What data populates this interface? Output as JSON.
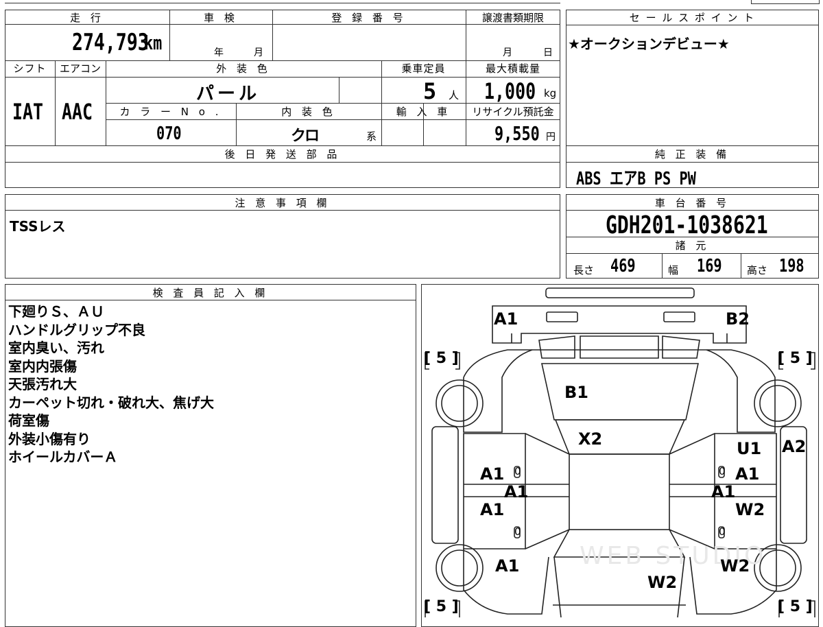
{
  "top_labels": {
    "mileage": "走 行",
    "inspection": "車 検",
    "registration": "登 録 番 号",
    "transfer_deadline": "譲渡書類期限",
    "sales_point": "セ ー ル ス ポ イ ン ト",
    "shift": "シフト",
    "aircon": "エアコン",
    "exterior_color": "外 装 色",
    "capacity": "乗車定員",
    "max_load": "最大積載量",
    "color_no": "カ ラ ー N o .",
    "interior_color": "内 装 色",
    "import": "輸 入 車",
    "recycle_fee": "リサイクル預託金",
    "later_parts": "後 日 発 送 部 品",
    "standard_equip": "純 正 装 備",
    "caution": "注 意 事 項 欄",
    "chassis_no": "車 台 番 号",
    "specs": "諸 元",
    "inspector": "検 査 員 記 入 欄"
  },
  "values": {
    "mileage": "274,793",
    "mileage_unit": "km",
    "inspection_year": "年",
    "inspection_month": "月",
    "transfer_month": "月",
    "transfer_day": "日",
    "sales_point": "★オークションデビュー★",
    "shift": "IAT",
    "aircon": "AAC",
    "exterior_color": "パ ー ル",
    "capacity": "5",
    "capacity_unit": "人",
    "max_load": "1,000",
    "max_load_unit": "kg",
    "color_no": "070",
    "interior_color": "クロ",
    "interior_suffix": "系",
    "recycle_fee": "9,550",
    "recycle_unit": "円",
    "standard_equip": "ABS エアB PS PW",
    "caution": "TSSレス",
    "chassis_no": "GDH201-1038621",
    "length_label": "長さ",
    "length": "469",
    "width_label": "幅",
    "width": "169",
    "height_label": "高さ",
    "height": "198"
  },
  "inspector_notes": [
    "下廻りＳ、ＡＵ",
    "ハンドルグリップ不良",
    "室内臭い、汚れ",
    "室内内張傷",
    "天張汚れ大",
    "カーペット切れ・破れ大、焦げ大",
    "荷室傷",
    "外装小傷有り",
    "ホイールカバーＡ"
  ],
  "diagram_marks": {
    "front_left": "A1",
    "front_right": "B2",
    "windshield": "B1",
    "roof": "X2",
    "rf_door_upper": "U1",
    "rf_fender": "A2",
    "rf_door_a1": "A1",
    "lf_door_a1": "A1",
    "left_sill": "A1",
    "right_sill": "A1",
    "lr_door": "A1",
    "rr_door": "W2",
    "lr_quarter": "A1",
    "rr_quarter": "W2",
    "rear_center": "W2",
    "tire_fl": "[ 5 ]",
    "tire_fr": "[ 5 ]",
    "tire_rl": "[ 5 ]",
    "tire_rr": "[ 5 ]",
    "zero": "0"
  },
  "watermark": "WEB STUDIO"
}
